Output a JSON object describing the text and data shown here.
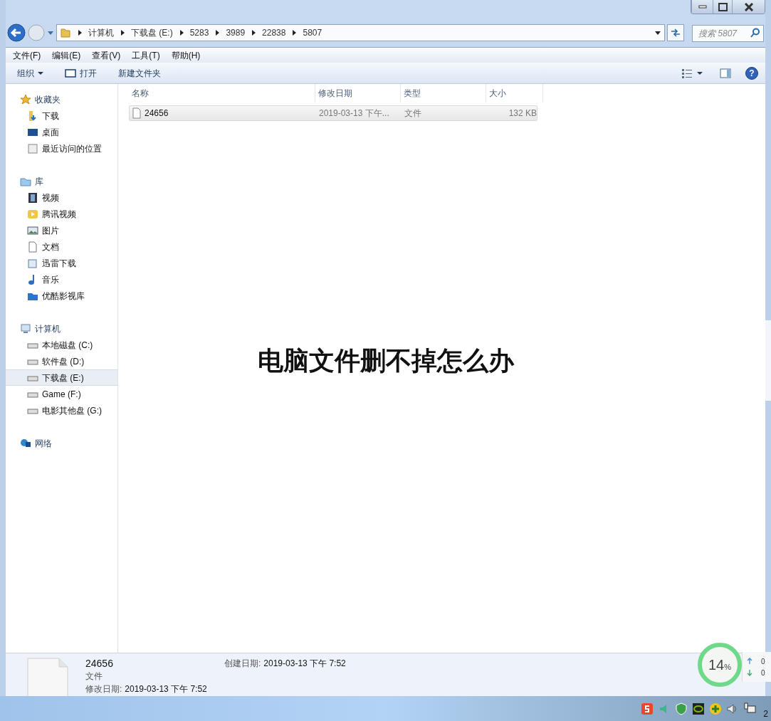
{
  "address_bar": {
    "crumbs": [
      "计算机",
      "下载盘 (E:)",
      "5283",
      "3989",
      "22838",
      "5807"
    ]
  },
  "search": {
    "placeholder": "搜索 5807"
  },
  "menu": [
    "文件(F)",
    "编辑(E)",
    "查看(V)",
    "工具(T)",
    "帮助(H)"
  ],
  "toolbar": {
    "buttons": [
      {
        "label": "组织",
        "kind": "dropdown"
      },
      {
        "label": "打开",
        "kind": "open"
      },
      {
        "label": "新建文件夹",
        "kind": "plain"
      }
    ],
    "help": "?"
  },
  "sidebar": [
    {
      "label": "收藏夹",
      "children": [
        {
          "label": "下载",
          "selected": false
        },
        {
          "label": "桌面",
          "selected": false
        },
        {
          "label": "最近访问的位置",
          "selected": false
        }
      ]
    },
    {
      "label": "库",
      "children": [
        {
          "label": "视频",
          "selected": false
        },
        {
          "label": "腾讯视频",
          "selected": false
        },
        {
          "label": "图片",
          "selected": false
        },
        {
          "label": "文档",
          "selected": false
        },
        {
          "label": "迅雷下载",
          "selected": false
        },
        {
          "label": "音乐",
          "selected": false
        },
        {
          "label": "优酷影视库",
          "selected": false
        }
      ]
    },
    {
      "label": "计算机",
      "children": [
        {
          "label": "本地磁盘 (C:)",
          "selected": false
        },
        {
          "label": "软件盘 (D:)",
          "selected": false
        },
        {
          "label": "下载盘 (E:)",
          "selected": true
        },
        {
          "label": "Game (F:)",
          "selected": false
        },
        {
          "label": "电影其他盘 (G:)",
          "selected": false
        }
      ]
    },
    {
      "label": "网络"
    }
  ],
  "table": {
    "columns": [
      "名称",
      "修改日期",
      "类型",
      "大小"
    ],
    "rows": [
      {
        "name": "24656",
        "modified": "2019-03-13 下午...",
        "type": "文件",
        "size": "132 KB",
        "selected": true
      }
    ]
  },
  "details": {
    "name": "24656",
    "type": "文件",
    "modified_label": "修改日期:",
    "modified": "2019-03-13 下午 7:52",
    "created_label": "创建日期:",
    "created": "2019-03-13 下午 7:52"
  },
  "speed_widget": {
    "percent": "14",
    "unit": "%",
    "up": "0",
    "down": "0"
  },
  "taskbar": {
    "clock": "2"
  },
  "overlay_title": "电脑文件删不掉怎么办"
}
